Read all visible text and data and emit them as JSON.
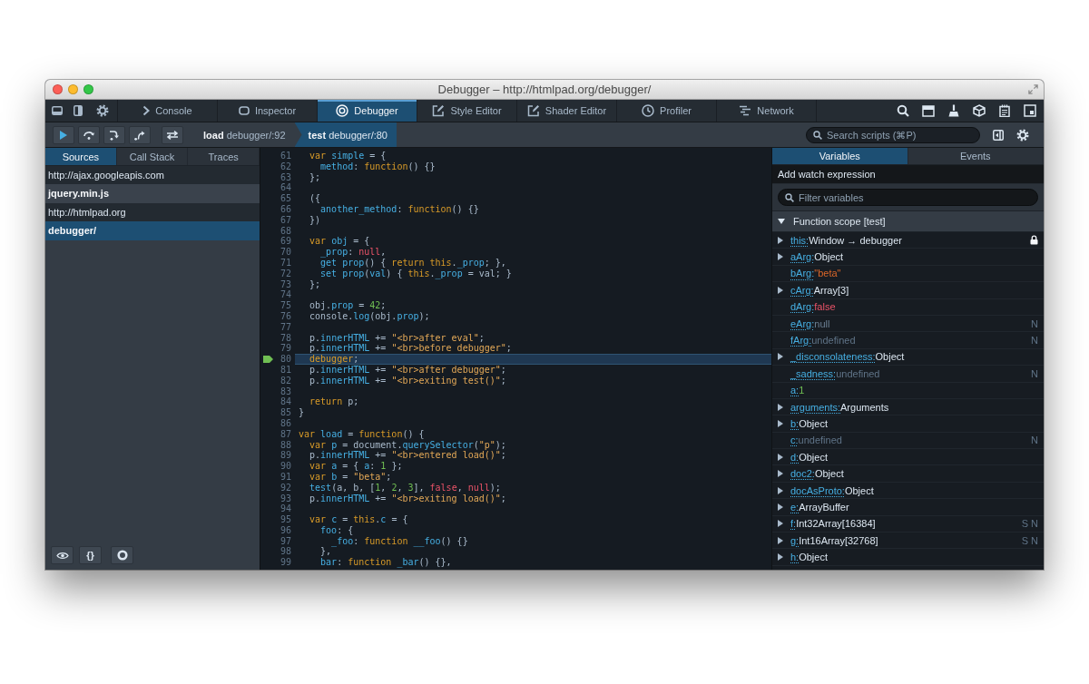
{
  "window": {
    "title": "Debugger – http://htmlpad.org/debugger/"
  },
  "toolbox_tabs": [
    {
      "label": "Console",
      "selected": false
    },
    {
      "label": "Inspector",
      "selected": false
    },
    {
      "label": "Debugger",
      "selected": true
    },
    {
      "label": "Style Editor",
      "selected": false
    },
    {
      "label": "Shader Editor",
      "selected": false
    },
    {
      "label": "Profiler",
      "selected": false
    },
    {
      "label": "Network",
      "selected": false
    }
  ],
  "debugger_toolbar": {
    "breadcrumbs": [
      {
        "function": "load",
        "location": "debugger/:92",
        "selected": false
      },
      {
        "function": "test",
        "location": "debugger/:80",
        "selected": true
      }
    ],
    "search": {
      "placeholder": "Search scripts (⌘P)"
    }
  },
  "sources_panel": {
    "tabs": [
      {
        "label": "Sources",
        "selected": true
      },
      {
        "label": "Call Stack",
        "selected": false
      },
      {
        "label": "Traces",
        "selected": false
      }
    ],
    "groups": [
      {
        "host": "http://ajax.googleapis.com",
        "items": [
          {
            "label": "jquery.min.js",
            "selected": false
          }
        ]
      },
      {
        "host": "http://htmlpad.org",
        "items": [
          {
            "label": "debugger/",
            "selected": true
          }
        ]
      }
    ],
    "footer": {
      "pretty_print_label": "{}"
    }
  },
  "editor": {
    "lines": [
      {
        "number": "61",
        "current": false,
        "tokens": [
          {
            "kind": "keyword",
            "text": "  var "
          },
          {
            "kind": "name",
            "text": "simple"
          },
          {
            "kind": "plain",
            "text": " = {"
          }
        ]
      },
      {
        "number": "62",
        "current": false,
        "tokens": [
          {
            "kind": "name",
            "text": "    method"
          },
          {
            "kind": "plain",
            "text": ": "
          },
          {
            "kind": "keyword",
            "text": "function"
          },
          {
            "kind": "plain",
            "text": "() {}"
          }
        ]
      },
      {
        "number": "63",
        "current": false,
        "tokens": [
          {
            "kind": "plain",
            "text": "  };"
          }
        ]
      },
      {
        "number": "64",
        "current": false
      },
      {
        "number": "65",
        "current": false,
        "tokens": [
          {
            "kind": "plain",
            "text": "  ({"
          }
        ]
      },
      {
        "number": "66",
        "current": false,
        "tokens": [
          {
            "kind": "name",
            "text": "    another_method"
          },
          {
            "kind": "plain",
            "text": ": "
          },
          {
            "kind": "keyword",
            "text": "function"
          },
          {
            "kind": "plain",
            "text": "() {}"
          }
        ]
      },
      {
        "number": "67",
        "current": false,
        "tokens": [
          {
            "kind": "plain",
            "text": "  })"
          }
        ]
      },
      {
        "number": "68",
        "current": false
      },
      {
        "number": "69",
        "current": false,
        "tokens": [
          {
            "kind": "keyword",
            "text": "  var "
          },
          {
            "kind": "name",
            "text": "obj"
          },
          {
            "kind": "plain",
            "text": " = {"
          }
        ]
      },
      {
        "number": "70",
        "current": false,
        "tokens": [
          {
            "kind": "name",
            "text": "    _prop"
          },
          {
            "kind": "plain",
            "text": ": "
          },
          {
            "kind": "atom",
            "text": "null"
          },
          {
            "kind": "plain",
            "text": ","
          }
        ]
      },
      {
        "number": "71",
        "current": false,
        "tokens": [
          {
            "kind": "name",
            "text": "    get prop"
          },
          {
            "kind": "plain",
            "text": "() { "
          },
          {
            "kind": "keyword",
            "text": "return this"
          },
          {
            "kind": "plain",
            "text": "."
          },
          {
            "kind": "name",
            "text": "_prop"
          },
          {
            "kind": "plain",
            "text": "; },"
          }
        ]
      },
      {
        "number": "72",
        "current": false,
        "tokens": [
          {
            "kind": "name",
            "text": "    set prop"
          },
          {
            "kind": "plain",
            "text": "("
          },
          {
            "kind": "name",
            "text": "val"
          },
          {
            "kind": "plain",
            "text": ") { "
          },
          {
            "kind": "keyword",
            "text": "this"
          },
          {
            "kind": "plain",
            "text": "."
          },
          {
            "kind": "name",
            "text": "_prop"
          },
          {
            "kind": "plain",
            "text": " = val; }"
          }
        ]
      },
      {
        "number": "73",
        "current": false,
        "tokens": [
          {
            "kind": "plain",
            "text": "  };"
          }
        ]
      },
      {
        "number": "74",
        "current": false
      },
      {
        "number": "75",
        "current": false,
        "tokens": [
          {
            "kind": "plain",
            "text": "  obj."
          },
          {
            "kind": "name",
            "text": "prop"
          },
          {
            "kind": "plain",
            "text": " = "
          },
          {
            "kind": "number",
            "text": "42"
          },
          {
            "kind": "plain",
            "text": ";"
          }
        ]
      },
      {
        "number": "76",
        "current": false,
        "tokens": [
          {
            "kind": "plain",
            "text": "  console."
          },
          {
            "kind": "name",
            "text": "log"
          },
          {
            "kind": "plain",
            "text": "(obj."
          },
          {
            "kind": "name",
            "text": "prop"
          },
          {
            "kind": "plain",
            "text": ");"
          }
        ]
      },
      {
        "number": "77",
        "current": false
      },
      {
        "number": "78",
        "current": false,
        "tokens": [
          {
            "kind": "plain",
            "text": "  p."
          },
          {
            "kind": "name",
            "text": "innerHTML"
          },
          {
            "kind": "plain",
            "text": " += "
          },
          {
            "kind": "string",
            "text": "\"<br>after eval\""
          },
          {
            "kind": "plain",
            "text": ";"
          }
        ]
      },
      {
        "number": "79",
        "current": false,
        "tokens": [
          {
            "kind": "plain",
            "text": "  p."
          },
          {
            "kind": "name",
            "text": "innerHTML"
          },
          {
            "kind": "plain",
            "text": " += "
          },
          {
            "kind": "string",
            "text": "\"<br>before debugger\""
          },
          {
            "kind": "plain",
            "text": ";"
          }
        ]
      },
      {
        "number": "80",
        "current": true,
        "tokens": [
          {
            "kind": "keyword",
            "text": "  debugger"
          },
          {
            "kind": "plain",
            "text": ";"
          }
        ]
      },
      {
        "number": "81",
        "current": false,
        "tokens": [
          {
            "kind": "plain",
            "text": "  p."
          },
          {
            "kind": "name",
            "text": "innerHTML"
          },
          {
            "kind": "plain",
            "text": " += "
          },
          {
            "kind": "string",
            "text": "\"<br>after debugger\""
          },
          {
            "kind": "plain",
            "text": ";"
          }
        ]
      },
      {
        "number": "82",
        "current": false,
        "tokens": [
          {
            "kind": "plain",
            "text": "  p."
          },
          {
            "kind": "name",
            "text": "innerHTML"
          },
          {
            "kind": "plain",
            "text": " += "
          },
          {
            "kind": "string",
            "text": "\"<br>exiting test()\""
          },
          {
            "kind": "plain",
            "text": ";"
          }
        ]
      },
      {
        "number": "83",
        "current": false
      },
      {
        "number": "84",
        "current": false,
        "tokens": [
          {
            "kind": "keyword",
            "text": "  return"
          },
          {
            "kind": "plain",
            "text": " p;"
          }
        ]
      },
      {
        "number": "85",
        "current": false,
        "tokens": [
          {
            "kind": "plain",
            "text": "}"
          }
        ]
      },
      {
        "number": "86",
        "current": false
      },
      {
        "number": "87",
        "current": false,
        "tokens": [
          {
            "kind": "keyword",
            "text": "var "
          },
          {
            "kind": "name",
            "text": "load"
          },
          {
            "kind": "plain",
            "text": " = "
          },
          {
            "kind": "keyword",
            "text": "function"
          },
          {
            "kind": "plain",
            "text": "() {"
          }
        ]
      },
      {
        "number": "88",
        "current": false,
        "tokens": [
          {
            "kind": "keyword",
            "text": "  var "
          },
          {
            "kind": "name",
            "text": "p"
          },
          {
            "kind": "plain",
            "text": " = document."
          },
          {
            "kind": "name",
            "text": "querySelector"
          },
          {
            "kind": "plain",
            "text": "("
          },
          {
            "kind": "string",
            "text": "\"p\""
          },
          {
            "kind": "plain",
            "text": ");"
          }
        ]
      },
      {
        "number": "89",
        "current": false,
        "tokens": [
          {
            "kind": "plain",
            "text": "  p."
          },
          {
            "kind": "name",
            "text": "innerHTML"
          },
          {
            "kind": "plain",
            "text": " += "
          },
          {
            "kind": "string",
            "text": "\"<br>entered load()\""
          },
          {
            "kind": "plain",
            "text": ";"
          }
        ]
      },
      {
        "number": "90",
        "current": false,
        "tokens": [
          {
            "kind": "keyword",
            "text": "  var "
          },
          {
            "kind": "name",
            "text": "a"
          },
          {
            "kind": "plain",
            "text": " = { "
          },
          {
            "kind": "name",
            "text": "a"
          },
          {
            "kind": "plain",
            "text": ": "
          },
          {
            "kind": "number",
            "text": "1"
          },
          {
            "kind": "plain",
            "text": " };"
          }
        ]
      },
      {
        "number": "91",
        "current": false,
        "tokens": [
          {
            "kind": "keyword",
            "text": "  var "
          },
          {
            "kind": "name",
            "text": "b"
          },
          {
            "kind": "plain",
            "text": " = "
          },
          {
            "kind": "string",
            "text": "\"beta\""
          },
          {
            "kind": "plain",
            "text": ";"
          }
        ]
      },
      {
        "number": "92",
        "current": false,
        "tokens": [
          {
            "kind": "name",
            "text": "  test"
          },
          {
            "kind": "plain",
            "text": "(a, b, ["
          },
          {
            "kind": "number",
            "text": "1"
          },
          {
            "kind": "plain",
            "text": ", "
          },
          {
            "kind": "number",
            "text": "2"
          },
          {
            "kind": "plain",
            "text": ", "
          },
          {
            "kind": "number",
            "text": "3"
          },
          {
            "kind": "plain",
            "text": "], "
          },
          {
            "kind": "atom",
            "text": "false"
          },
          {
            "kind": "plain",
            "text": ", "
          },
          {
            "kind": "atom",
            "text": "null"
          },
          {
            "kind": "plain",
            "text": ");"
          }
        ]
      },
      {
        "number": "93",
        "current": false,
        "tokens": [
          {
            "kind": "plain",
            "text": "  p."
          },
          {
            "kind": "name",
            "text": "innerHTML"
          },
          {
            "kind": "plain",
            "text": " += "
          },
          {
            "kind": "string",
            "text": "\"<br>exiting load()\""
          },
          {
            "kind": "plain",
            "text": ";"
          }
        ]
      },
      {
        "number": "94",
        "current": false
      },
      {
        "number": "95",
        "current": false,
        "tokens": [
          {
            "kind": "keyword",
            "text": "  var "
          },
          {
            "kind": "name",
            "text": "c"
          },
          {
            "kind": "plain",
            "text": " = "
          },
          {
            "kind": "keyword",
            "text": "this"
          },
          {
            "kind": "plain",
            "text": "."
          },
          {
            "kind": "name",
            "text": "c"
          },
          {
            "kind": "plain",
            "text": " = {"
          }
        ]
      },
      {
        "number": "96",
        "current": false,
        "tokens": [
          {
            "kind": "name",
            "text": "    foo"
          },
          {
            "kind": "plain",
            "text": ": {"
          }
        ]
      },
      {
        "number": "97",
        "current": false,
        "tokens": [
          {
            "kind": "name",
            "text": "      _foo"
          },
          {
            "kind": "plain",
            "text": ": "
          },
          {
            "kind": "keyword",
            "text": "function "
          },
          {
            "kind": "name",
            "text": "__foo"
          },
          {
            "kind": "plain",
            "text": "() {}"
          }
        ]
      },
      {
        "number": "98",
        "current": false,
        "tokens": [
          {
            "kind": "plain",
            "text": "    },"
          }
        ]
      },
      {
        "number": "99",
        "current": false,
        "tokens": [
          {
            "kind": "name",
            "text": "    bar"
          },
          {
            "kind": "plain",
            "text": ": "
          },
          {
            "kind": "keyword",
            "text": "function "
          },
          {
            "kind": "name",
            "text": "_bar"
          },
          {
            "kind": "plain",
            "text": "() {},"
          }
        ]
      }
    ]
  },
  "variables_panel": {
    "tabs": [
      {
        "label": "Variables",
        "selected": true
      },
      {
        "label": "Events",
        "selected": false
      }
    ],
    "watch_prompt": "Add watch expression",
    "filter": {
      "placeholder": "Filter variables"
    },
    "scopes": [
      {
        "title": "Function scope [test]",
        "expanded": true,
        "variables": [
          {
            "name": "this:",
            "value": "Window → debugger",
            "kind": "object",
            "expandable": true,
            "locked": true
          },
          {
            "name": "aArg:",
            "value": "Object",
            "kind": "object",
            "expandable": true,
            "locked": false
          },
          {
            "name": "bArg:",
            "value": "\"beta\"",
            "kind": "string",
            "expandable": false,
            "locked": false
          },
          {
            "name": "cArg:",
            "value": "Array[3]",
            "kind": "object",
            "expandable": true,
            "locked": false
          },
          {
            "name": "dArg:",
            "value": "false",
            "kind": "boolean",
            "expandable": false,
            "locked": false
          },
          {
            "name": "eArg:",
            "value": "null",
            "kind": "null",
            "expandable": false,
            "locked": false,
            "flags": "N"
          },
          {
            "name": "fArg:",
            "value": "undefined",
            "kind": "undefined",
            "expandable": false,
            "locked": false,
            "flags": "N"
          },
          {
            "name": "_disconsolateness:",
            "value": "Object",
            "kind": "object",
            "expandable": true,
            "locked": false
          },
          {
            "name": "_sadness:",
            "value": "undefined",
            "kind": "undefined",
            "expandable": false,
            "locked": false,
            "flags": "N"
          },
          {
            "name": "a:",
            "value": "1",
            "kind": "number",
            "expandable": false,
            "locked": false
          },
          {
            "name": "arguments:",
            "value": "Arguments",
            "kind": "object",
            "expandable": true,
            "locked": false
          },
          {
            "name": "b:",
            "value": "Object",
            "kind": "object",
            "expandable": true,
            "locked": false
          },
          {
            "name": "c:",
            "value": "undefined",
            "kind": "undefined",
            "expandable": false,
            "locked": false,
            "flags": "N"
          },
          {
            "name": "d:",
            "value": "Object",
            "kind": "object",
            "expandable": true,
            "locked": false
          },
          {
            "name": "doc2:",
            "value": "Object",
            "kind": "object",
            "expandable": true,
            "locked": false
          },
          {
            "name": "docAsProto:",
            "value": "Object",
            "kind": "object",
            "expandable": true,
            "locked": false
          },
          {
            "name": "e:",
            "value": "ArrayBuffer",
            "kind": "object",
            "expandable": true,
            "locked": false
          },
          {
            "name": "f:",
            "value": "Int32Array[16384]",
            "kind": "object",
            "expandable": true,
            "locked": false,
            "flags": "S N"
          },
          {
            "name": "g:",
            "value": "Int16Array[32768]",
            "kind": "object",
            "expandable": true,
            "locked": false,
            "flags": "S N"
          },
          {
            "name": "h:",
            "value": "Object",
            "kind": "object",
            "expandable": true,
            "locked": false
          }
        ]
      }
    ]
  }
}
